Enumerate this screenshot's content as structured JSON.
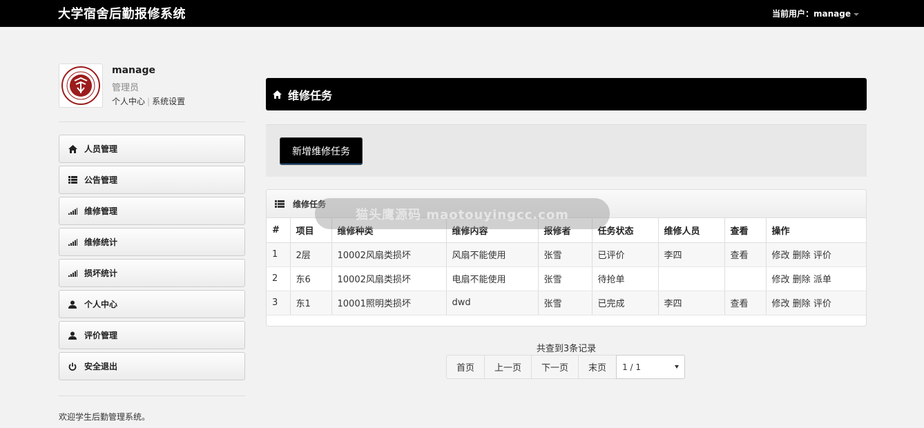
{
  "app": {
    "title": "大学宿舍后勤报修系统",
    "current_user": "当前用户：manage"
  },
  "profile": {
    "username": "manage",
    "role": "管理员",
    "links": [
      "个人中心",
      "系统设置"
    ]
  },
  "sidebar": {
    "items": [
      {
        "label": "人员管理",
        "icon": "home-icon"
      },
      {
        "label": "公告管理",
        "icon": "list-icon"
      },
      {
        "label": "维修管理",
        "icon": "signal-icon"
      },
      {
        "label": "维修统计",
        "icon": "signal-icon"
      },
      {
        "label": "损坏统计",
        "icon": "signal-icon"
      },
      {
        "label": "个人中心",
        "icon": "user-icon"
      },
      {
        "label": "评价管理",
        "icon": "user-icon"
      },
      {
        "label": "安全退出",
        "icon": "power-icon"
      }
    ]
  },
  "footer": {
    "text": "欢迎学生后勤管理系统。"
  },
  "page": {
    "header": "维修任务",
    "add_button": "新增维修任务",
    "panel_title": "维修任务",
    "watermark": "猫头鹰源码 maotouyingcc.com"
  },
  "table": {
    "columns": [
      "#",
      "项目",
      "维修种类",
      "维修内容",
      "报修者",
      "任务状态",
      "维修人员",
      "查看",
      "操作"
    ],
    "rows": [
      {
        "no": "1",
        "project": "2层",
        "type": "10002风扇类损坏",
        "content": "风扇不能使用",
        "reporter": "张雪",
        "status": "已评价",
        "worker": "李四",
        "view": "查看",
        "actions": [
          "修改",
          "删除",
          "评价"
        ]
      },
      {
        "no": "2",
        "project": "东6",
        "type": "10002风扇类损坏",
        "content": "电扇不能使用",
        "reporter": "张雪",
        "status": "待抢单",
        "worker": "",
        "view": "",
        "actions": [
          "修改",
          "删除",
          "派单"
        ]
      },
      {
        "no": "3",
        "project": "东1",
        "type": "10001照明类损坏",
        "content": "dwd",
        "reporter": "张雪",
        "status": "已完成",
        "worker": "李四",
        "view": "查看",
        "actions": [
          "修改",
          "删除",
          "评价"
        ]
      }
    ]
  },
  "pagination": {
    "record_count": "共查到3条记录",
    "first": "首页",
    "prev": "上一页",
    "next": "下一页",
    "last": "末页",
    "page_value": "1 / 1"
  },
  "colors": {
    "topbar": "#000000",
    "header": "#000000",
    "logo_red": "#9b1c1c"
  }
}
